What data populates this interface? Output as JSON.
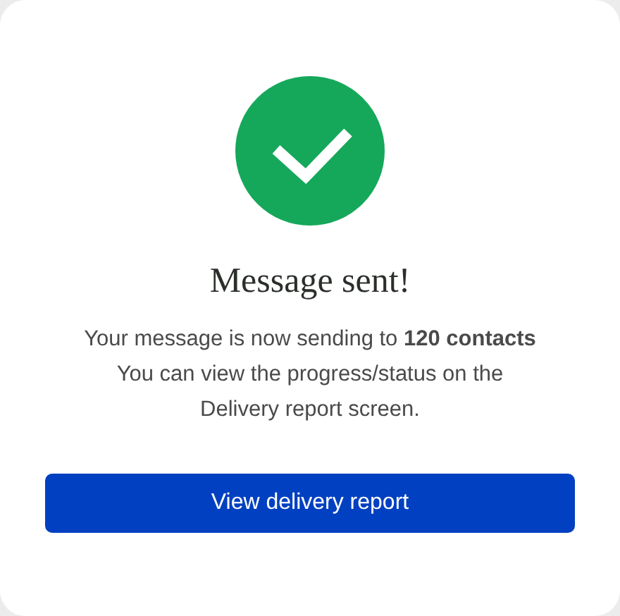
{
  "dialog": {
    "success": true,
    "title": "Message sent!",
    "message": "Your message is now sending to **120 contacts**\nYou can view the progress/status on the\nDelivery report screen.",
    "button": "View delivery report"
  }
}
